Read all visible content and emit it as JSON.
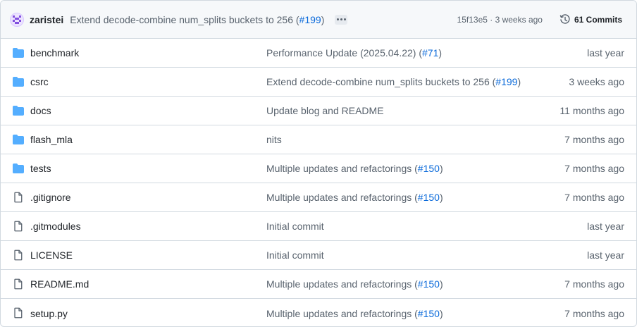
{
  "header": {
    "author": "zaristei",
    "message": "Extend decode-combine num_splits buckets to 256 (",
    "message_pr": "#199",
    "message_close": ")",
    "sha_time": "15f13e5 · 3 weeks ago",
    "commits_label": "61 Commits"
  },
  "colors": {
    "folder": "#54aeff",
    "link": "#0969da",
    "muted": "#59636e",
    "border": "#d1d9e0"
  },
  "files": [
    {
      "type": "folder",
      "icon": "folder-icon",
      "name": "benchmark",
      "msg": "Performance Update (2025.04.22) (",
      "pr": "#71",
      "close": ")",
      "date": "last year"
    },
    {
      "type": "folder",
      "icon": "folder-icon",
      "name": "csrc",
      "msg": "Extend decode-combine num_splits buckets to 256 (",
      "pr": "#199",
      "close": ")",
      "date": "3 weeks ago"
    },
    {
      "type": "folder",
      "icon": "folder-icon",
      "name": "docs",
      "msg": "Update blog and README",
      "pr": "",
      "close": "",
      "date": "11 months ago"
    },
    {
      "type": "folder",
      "icon": "folder-icon",
      "name": "flash_mla",
      "msg": "nits",
      "pr": "",
      "close": "",
      "date": "7 months ago"
    },
    {
      "type": "folder",
      "icon": "folder-icon",
      "name": "tests",
      "msg": "Multiple updates and refactorings (",
      "pr": "#150",
      "close": ")",
      "date": "7 months ago"
    },
    {
      "type": "file",
      "icon": "file-icon",
      "name": ".gitignore",
      "msg": "Multiple updates and refactorings (",
      "pr": "#150",
      "close": ")",
      "date": "7 months ago"
    },
    {
      "type": "file",
      "icon": "file-icon",
      "name": ".gitmodules",
      "msg": "Initial commit",
      "pr": "",
      "close": "",
      "date": "last year"
    },
    {
      "type": "file",
      "icon": "file-icon",
      "name": "LICENSE",
      "msg": "Initial commit",
      "pr": "",
      "close": "",
      "date": "last year"
    },
    {
      "type": "file",
      "icon": "file-icon",
      "name": "README.md",
      "msg": "Multiple updates and refactorings (",
      "pr": "#150",
      "close": ")",
      "date": "7 months ago"
    },
    {
      "type": "file",
      "icon": "file-icon",
      "name": "setup.py",
      "msg": "Multiple updates and refactorings (",
      "pr": "#150",
      "close": ")",
      "date": "7 months ago"
    }
  ]
}
